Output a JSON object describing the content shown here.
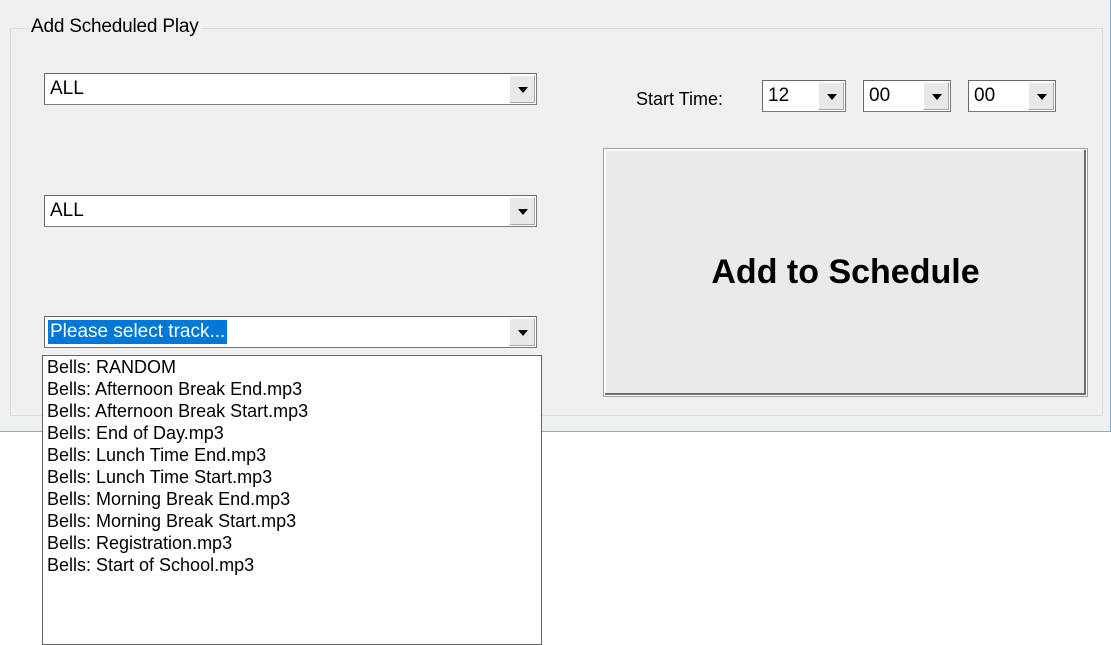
{
  "group_title": "Add Scheduled Play",
  "combo1": {
    "value": "ALL"
  },
  "combo2": {
    "value": "ALL"
  },
  "track_combo": {
    "value": "Please select track..."
  },
  "start_time": {
    "label": "Start Time:",
    "hour": "12",
    "minute": "00",
    "second": "00"
  },
  "add_button": {
    "label": "Add to Schedule"
  },
  "track_list": [
    "Bells: RANDOM",
    "Bells: Afternoon Break End.mp3",
    "Bells: Afternoon Break Start.mp3",
    "Bells: End of Day.mp3",
    "Bells: Lunch Time End.mp3",
    "Bells: Lunch Time Start.mp3",
    "Bells: Morning Break End.mp3",
    "Bells: Morning Break Start.mp3",
    "Bells: Registration.mp3",
    "Bells: Start of School.mp3"
  ]
}
